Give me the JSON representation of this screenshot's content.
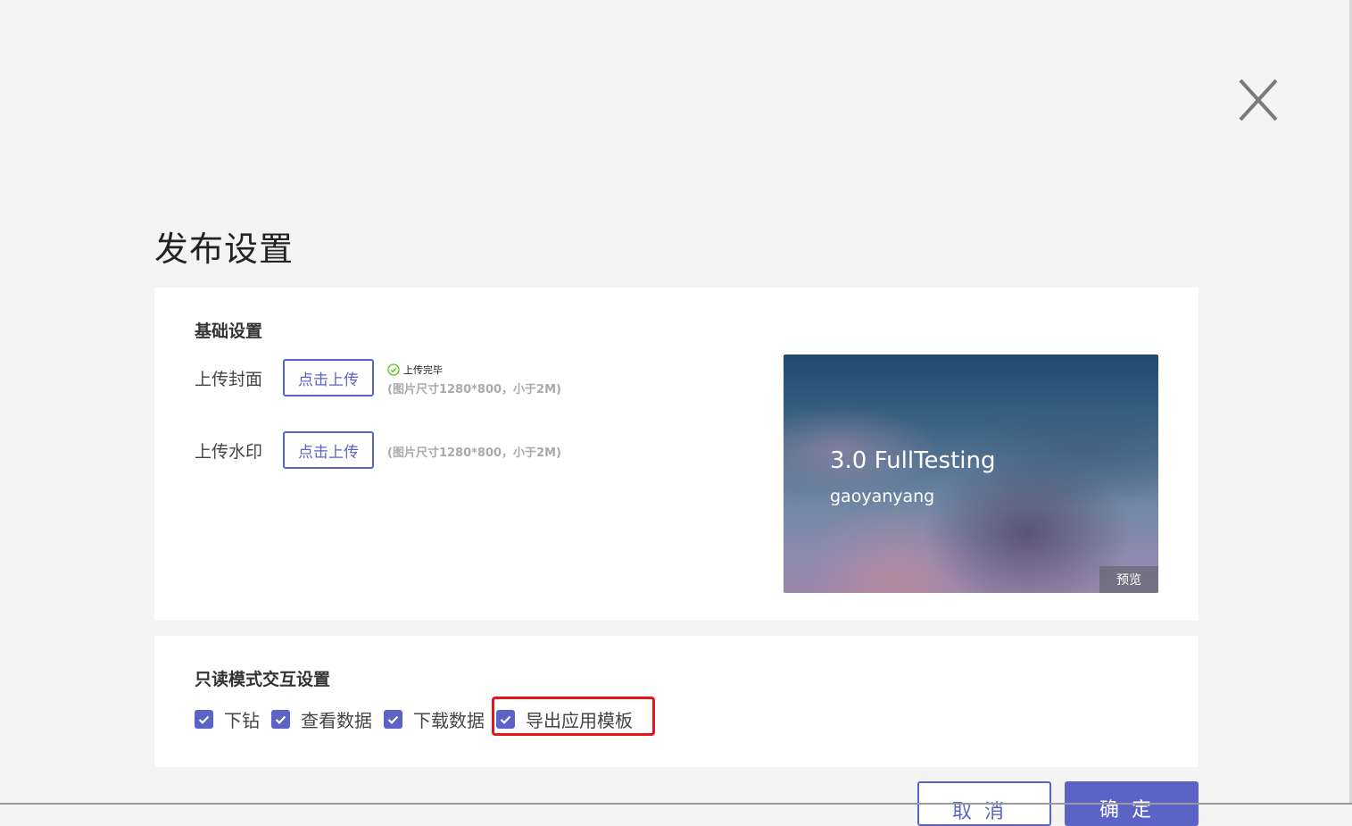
{
  "dialog": {
    "title": "发布设置"
  },
  "basic_settings": {
    "section_title": "基础设置",
    "cover": {
      "label": "上传封面",
      "button": "点击上传",
      "status": "上传完毕",
      "hint": "(图片尺寸1280*800，小于2M)"
    },
    "watermark": {
      "label": "上传水印",
      "button": "点击上传",
      "hint": "(图片尺寸1280*800，小于2M)"
    },
    "preview_card": {
      "title": "3.0 FullTesting",
      "subtitle": "gaoyanyang",
      "preview_button": "预览"
    }
  },
  "readonly_settings": {
    "section_title": "只读模式交互设置",
    "options": [
      {
        "label": "下钻",
        "checked": true
      },
      {
        "label": "查看数据",
        "checked": true
      },
      {
        "label": "下载数据",
        "checked": true
      },
      {
        "label": "导出应用模板",
        "checked": true
      }
    ]
  },
  "footer": {
    "cancel": "取消",
    "confirm": "确定"
  },
  "colors": {
    "accent": "#5b63c6",
    "highlight": "#e8141a",
    "success": "#52c41a",
    "background": "#f4f4f4"
  }
}
